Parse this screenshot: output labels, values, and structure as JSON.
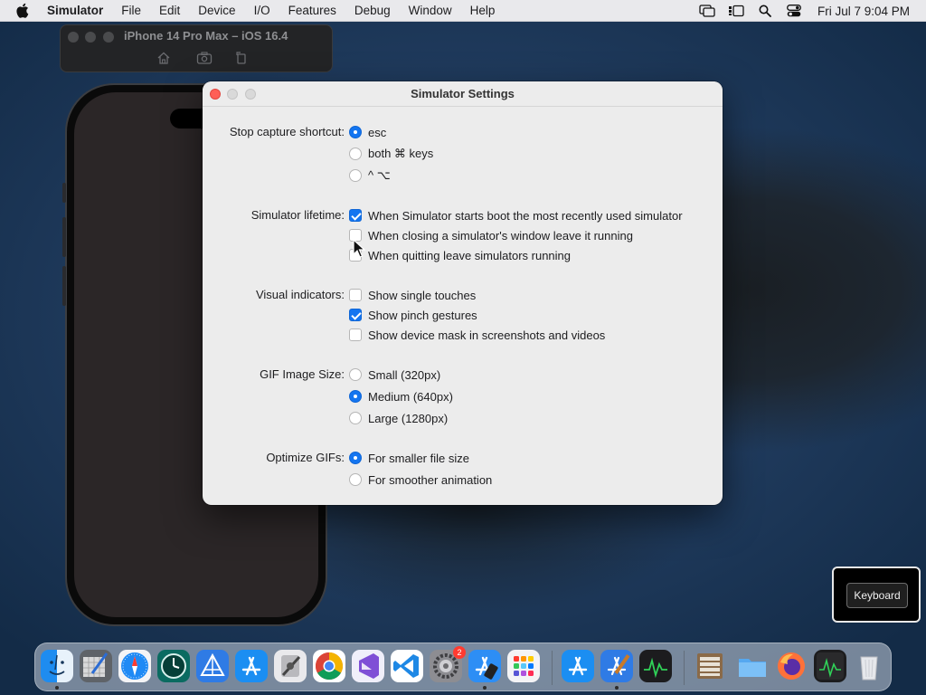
{
  "menubar": {
    "app_name": "Simulator",
    "items": [
      "File",
      "Edit",
      "Device",
      "I/O",
      "Features",
      "Debug",
      "Window",
      "Help"
    ],
    "clock": "Fri Jul 7  9:04 PM"
  },
  "simulator_window": {
    "title": "iPhone 14 Pro Max – iOS 16.4"
  },
  "settings": {
    "title": "Simulator Settings",
    "stop_capture": {
      "label": "Stop capture shortcut:",
      "options": [
        "esc",
        "both ⌘ keys",
        "^ ⌥"
      ],
      "selected": "esc"
    },
    "lifetime": {
      "label": "Simulator lifetime:",
      "options": [
        {
          "label": "When Simulator starts boot the most recently used simulator",
          "checked": true
        },
        {
          "label": "When closing a simulator's window leave it running",
          "checked": false
        },
        {
          "label": "When quitting leave simulators running",
          "checked": false
        }
      ]
    },
    "visual_indicators": {
      "label": "Visual indicators:",
      "options": [
        {
          "label": "Show single touches",
          "checked": false
        },
        {
          "label": "Show pinch gestures",
          "checked": true
        },
        {
          "label": "Show device mask in screenshots and videos",
          "checked": false
        }
      ]
    },
    "gif_size": {
      "label": "GIF Image Size:",
      "options": [
        "Small (320px)",
        "Medium (640px)",
        "Large (1280px)"
      ],
      "selected": "Medium (640px)"
    },
    "optimize_gifs": {
      "label": "Optimize GIFs:",
      "options": [
        "For smaller file size",
        "For smoother animation"
      ],
      "selected": "For smaller file size"
    }
  },
  "keyboard_panel": {
    "button_label": "Keyboard"
  },
  "dock": {
    "settings_badge": "2",
    "accent_colors": {
      "close": "#ff5f57",
      "selection": "#1475f0"
    }
  }
}
